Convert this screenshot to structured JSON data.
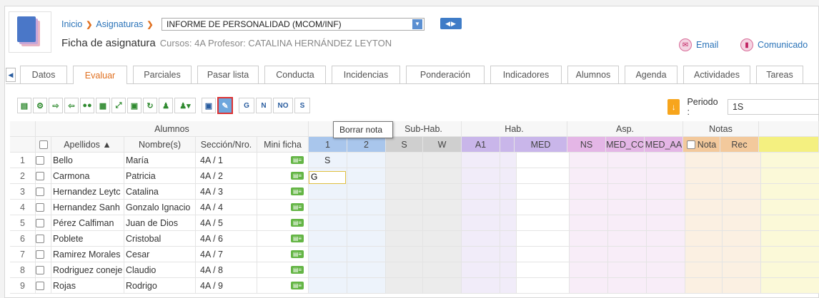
{
  "breadcrumb": {
    "home": "Inicio",
    "section": "Asignaturas"
  },
  "subject_select": {
    "value": "INFORME DE PERSONALIDAD (MCOM/INF)"
  },
  "ficha": {
    "title": "Ficha de asignatura",
    "subtitle": "Cursos: 4A Profesor: CATALINA HERNÁNDEZ LEYTON"
  },
  "header_actions": {
    "email": "Email",
    "comunicado": "Comunicado"
  },
  "tabs": [
    "Datos",
    "Evaluar",
    "Parciales",
    "Pasar lista",
    "Conducta",
    "Incidencias",
    "Ponderación",
    "Indicadores",
    "Alumnos",
    "Agenda",
    "Actividades",
    "Tareas"
  ],
  "toolbar": {
    "letters": [
      "G",
      "N",
      "NO",
      "S"
    ],
    "tooltip": "Borrar nota"
  },
  "periodo": {
    "label": "Periodo :",
    "value": "1S"
  },
  "grid": {
    "group_headers": {
      "alumnos": "Alumnos",
      "subhab": "Sub-Hab.",
      "hab": "Hab.",
      "asp": "Asp.",
      "notas": "Notas"
    },
    "columns": {
      "apellidos": "Apellidos ▲",
      "nombres": "Nombre(s)",
      "seccion": "Sección/Nro.",
      "mini": "Mini ficha"
    },
    "eval_cols": [
      "1",
      "2",
      "S",
      "W",
      "A1",
      "",
      "MED",
      "NS",
      "MED_CC",
      "MED_AA",
      "Nota",
      "Rec"
    ],
    "rows": [
      {
        "n": "1",
        "apellido": "Bello",
        "nombre": "María",
        "seccion": "4A / 1",
        "c1": "S"
      },
      {
        "n": "2",
        "apellido": "Carmona",
        "nombre": "Patricia",
        "seccion": "4A / 2",
        "c1": ""
      },
      {
        "n": "3",
        "apellido": "Hernandez Leytc",
        "nombre": "Catalina",
        "seccion": "4A / 3",
        "c1": ""
      },
      {
        "n": "4",
        "apellido": "Hernandez Sanh",
        "nombre": "Gonzalo Ignacio",
        "seccion": "4A / 4",
        "c1": ""
      },
      {
        "n": "5",
        "apellido": "Pérez Calfiman",
        "nombre": "Juan de Dios",
        "seccion": "4A / 5",
        "c1": ""
      },
      {
        "n": "6",
        "apellido": "Poblete",
        "nombre": "Cristobal",
        "seccion": "4A / 6",
        "c1": ""
      },
      {
        "n": "7",
        "apellido": "Ramirez Morales",
        "nombre": "Cesar",
        "seccion": "4A / 7",
        "c1": ""
      },
      {
        "n": "8",
        "apellido": "Rodriguez coneje",
        "nombre": "Claudio",
        "seccion": "4A / 8",
        "c1": ""
      },
      {
        "n": "9",
        "apellido": "Rojas",
        "nombre": "Rodrigo",
        "seccion": "4A / 9",
        "c1": ""
      }
    ],
    "editing_value": "G"
  }
}
